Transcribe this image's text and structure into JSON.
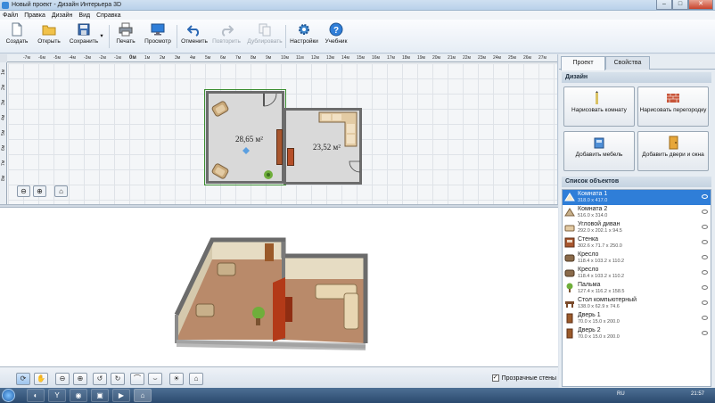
{
  "window": {
    "title": "Новый проект - Дизайн Интерьера 3D"
  },
  "menu": [
    "Файл",
    "Правка",
    "Дизайн",
    "Вид",
    "Справка"
  ],
  "toolbar": {
    "create": "Создать",
    "open": "Открыть",
    "save": "Сохранить",
    "print": "Печать",
    "preview": "Просмотр",
    "undo": "Отменить",
    "redo": "Повторить",
    "duplicate": "Дублировать",
    "settings": "Настройки",
    "tutorial": "Учебник"
  },
  "ruler": {
    "top": [
      "-7м",
      "-6м",
      "-5м",
      "-4м",
      "-3м",
      "-2м",
      "-1м",
      "0м",
      "1м",
      "2м",
      "3м",
      "4м",
      "5м",
      "6м",
      "7м",
      "8м",
      "9м",
      "10м",
      "11м",
      "12м",
      "13м",
      "14м",
      "15м",
      "16м",
      "17м",
      "18м",
      "19м",
      "20м",
      "21м",
      "22м",
      "23м",
      "24м",
      "25м",
      "26м",
      "27м"
    ],
    "left": [
      "1м",
      "2м",
      "3м",
      "4м",
      "5м",
      "6м",
      "7м",
      "8м"
    ]
  },
  "plan": {
    "room1_area": "28,65 м²",
    "room2_area": "23,52 м²"
  },
  "view3d_bar": {
    "transparent_walls_label": "Прозрачные стены",
    "transparent_walls_checked": true
  },
  "right_panel": {
    "tabs": [
      "Проект",
      "Свойства"
    ],
    "active_tab": "Проект",
    "design_header": "Дизайн",
    "buttons": {
      "draw_room": "Нарисовать комнату",
      "draw_partition": "Нарисовать перегородку",
      "add_furniture": "Добавить мебель",
      "add_doors_windows": "Добавить двери и окна"
    },
    "objects_header": "Список объектов",
    "objects": [
      {
        "name": "Комната 1",
        "size": "318.0 x 417.0"
      },
      {
        "name": "Комната 2",
        "size": "516.0 x 314.0"
      },
      {
        "name": "Угловой диван",
        "size": "292.0 x 202.1 x 94.5"
      },
      {
        "name": "Стенка",
        "size": "302.6 x 71.7 x 250.0"
      },
      {
        "name": "Кресло",
        "size": "118.4 x 103.2 x 110.2"
      },
      {
        "name": "Кресло",
        "size": "118.4 x 103.2 x 110.2"
      },
      {
        "name": "Пальма",
        "size": "127.4 x 116.2 x 158.5"
      },
      {
        "name": "Стол компьютерный",
        "size": "138.0 x 62.9 x 74.6"
      },
      {
        "name": "Дверь 1",
        "size": "70.0 x 15.0 x 200.0"
      },
      {
        "name": "Дверь 2",
        "size": "70.0 x 15.0 x 200.0"
      }
    ]
  },
  "taskbar": {
    "lang": "RU",
    "time": "21:57"
  },
  "colors": {
    "selection": "#2f7ed8",
    "room_floor": "#d9d9d9",
    "wall": "#6c6c6c",
    "selected_outline": "#3a8e2f"
  }
}
